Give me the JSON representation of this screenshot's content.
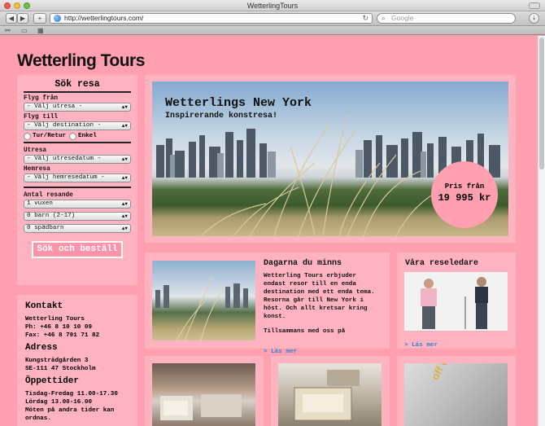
{
  "browser": {
    "window_title": "WetterlingTours",
    "url": "http://wetterlingtours.com/",
    "search_placeholder": "Google",
    "back_label": "◀",
    "forward_label": "▶",
    "add_label": "+",
    "reload_label": "↻"
  },
  "site": {
    "logo": "Wetterling Tours"
  },
  "search_form": {
    "title": "Sök resa",
    "from_label": "Flyg från",
    "from_value": "- Välj utresa -",
    "to_label": "Flyg till",
    "to_value": "- Välj destination -",
    "trip_roundtrip": "Tur/Retur",
    "trip_oneway": "Enkel",
    "depart_label": "Utresa",
    "depart_value": "- Välj utresedatum -",
    "return_label": "Hemresa",
    "return_value": "- Välj hemresedatum -",
    "travelers_label": "Antal resande",
    "adults_value": "1 vuxen",
    "children_value": "0 barn (2-17)",
    "infants_value": "0 spädbarn",
    "submit_label": "Sök och beställ"
  },
  "contact": {
    "heading": "Kontakt",
    "company": "Wetterling Tours",
    "phone": "Ph: +46 8 10 10 09",
    "fax": "Fax: +46 8 791 71 82",
    "address_heading": "Adress",
    "street": "Kungsträdgården 3",
    "city": "SE-111 47 Stockholm",
    "hours_heading": "Öppettider",
    "hours_weekday": "Tisdag-Fredag 11.00-17.30",
    "hours_saturday": "Lördag 13.00-16.00",
    "hours_note_1": "Möten på andra tider kan",
    "hours_note_2": "ordnas."
  },
  "hero": {
    "title": "Wetterlings New York",
    "subtitle": "Inspirerande konstresa!",
    "price_label": "Pris från",
    "price_value": "19 995 kr"
  },
  "card_days": {
    "heading": "Dagarna du minns",
    "body_1": "Wetterling Tours erbjuder",
    "body_2": "endast resor till en enda",
    "body_3": "destination med ett enda tema.",
    "body_4": "Resorna går till New York i",
    "body_5": "höst. Och allt kretsar kring",
    "body_6": "konst.",
    "body_7": "Tillsammans med oss på",
    "link": "> Läs mer"
  },
  "card_guides": {
    "heading": "Våra reseledare",
    "link": "> Läs mer"
  },
  "bottom_card_text": "off the wall",
  "colors": {
    "page_bg": "#ff9fb0",
    "panel_bg": "#ffb3c0",
    "link": "#2c84d8"
  }
}
